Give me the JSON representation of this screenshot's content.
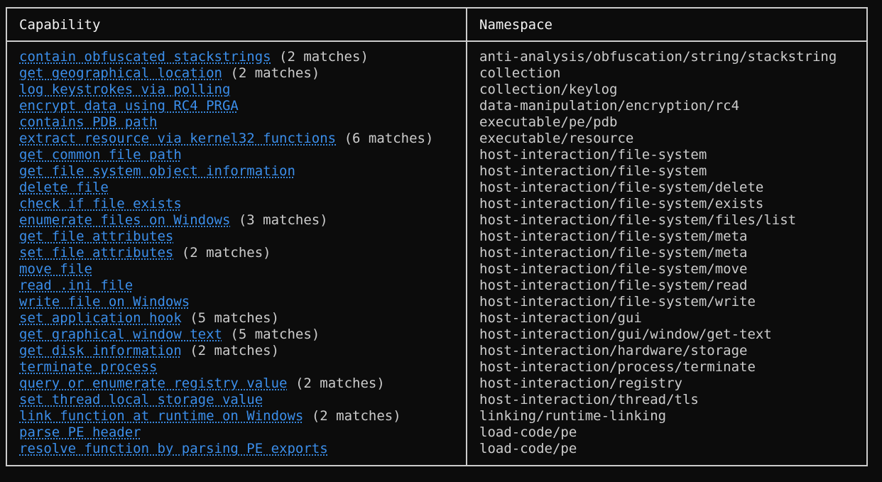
{
  "table": {
    "header": {
      "capability": "Capability",
      "namespace": "Namespace"
    },
    "rows": [
      {
        "capability": "contain obfuscated stackstrings",
        "matches": " (2 matches)",
        "namespace": "anti-analysis/obfuscation/string/stackstring"
      },
      {
        "capability": "get geographical location",
        "matches": " (2 matches)",
        "namespace": "collection"
      },
      {
        "capability": "log keystrokes via polling",
        "matches": "",
        "namespace": "collection/keylog"
      },
      {
        "capability": "encrypt data using RC4 PRGA",
        "matches": "",
        "namespace": "data-manipulation/encryption/rc4"
      },
      {
        "capability": "contains PDB path",
        "matches": "",
        "namespace": "executable/pe/pdb"
      },
      {
        "capability": "extract resource via kernel32 functions",
        "matches": " (6 matches)",
        "namespace": "executable/resource"
      },
      {
        "capability": "get common file path",
        "matches": "",
        "namespace": "host-interaction/file-system"
      },
      {
        "capability": "get file system object information",
        "matches": "",
        "namespace": "host-interaction/file-system"
      },
      {
        "capability": "delete file",
        "matches": "",
        "namespace": "host-interaction/file-system/delete"
      },
      {
        "capability": "check if file exists",
        "matches": "",
        "namespace": "host-interaction/file-system/exists"
      },
      {
        "capability": "enumerate files on Windows",
        "matches": " (3 matches)",
        "namespace": "host-interaction/file-system/files/list"
      },
      {
        "capability": "get file attributes",
        "matches": "",
        "namespace": "host-interaction/file-system/meta"
      },
      {
        "capability": "set file attributes",
        "matches": " (2 matches)",
        "namespace": "host-interaction/file-system/meta"
      },
      {
        "capability": "move file",
        "matches": "",
        "namespace": "host-interaction/file-system/move"
      },
      {
        "capability": "read .ini file",
        "matches": "",
        "namespace": "host-interaction/file-system/read"
      },
      {
        "capability": "write file on Windows",
        "matches": "",
        "namespace": "host-interaction/file-system/write"
      },
      {
        "capability": "set application hook",
        "matches": " (5 matches)",
        "namespace": "host-interaction/gui"
      },
      {
        "capability": "get graphical window text",
        "matches": " (5 matches)",
        "namespace": "host-interaction/gui/window/get-text"
      },
      {
        "capability": "get disk information",
        "matches": " (2 matches)",
        "namespace": "host-interaction/hardware/storage"
      },
      {
        "capability": "terminate process",
        "matches": "",
        "namespace": "host-interaction/process/terminate"
      },
      {
        "capability": "query or enumerate registry value",
        "matches": " (2 matches)",
        "namespace": "host-interaction/registry"
      },
      {
        "capability": "set thread local storage value",
        "matches": "",
        "namespace": "host-interaction/thread/tls"
      },
      {
        "capability": "link function at runtime on Windows",
        "matches": " (2 matches)",
        "namespace": "linking/runtime-linking"
      },
      {
        "capability": "parse PE header",
        "matches": "",
        "namespace": "load-code/pe"
      },
      {
        "capability": "resolve function by parsing PE exports",
        "matches": "",
        "namespace": "load-code/pe"
      }
    ]
  },
  "colors": {
    "background": "#0c0c0c",
    "border": "#cccccc",
    "link": "#3b8eea",
    "text": "#cccccc",
    "header_text": "#f2f2f2"
  }
}
